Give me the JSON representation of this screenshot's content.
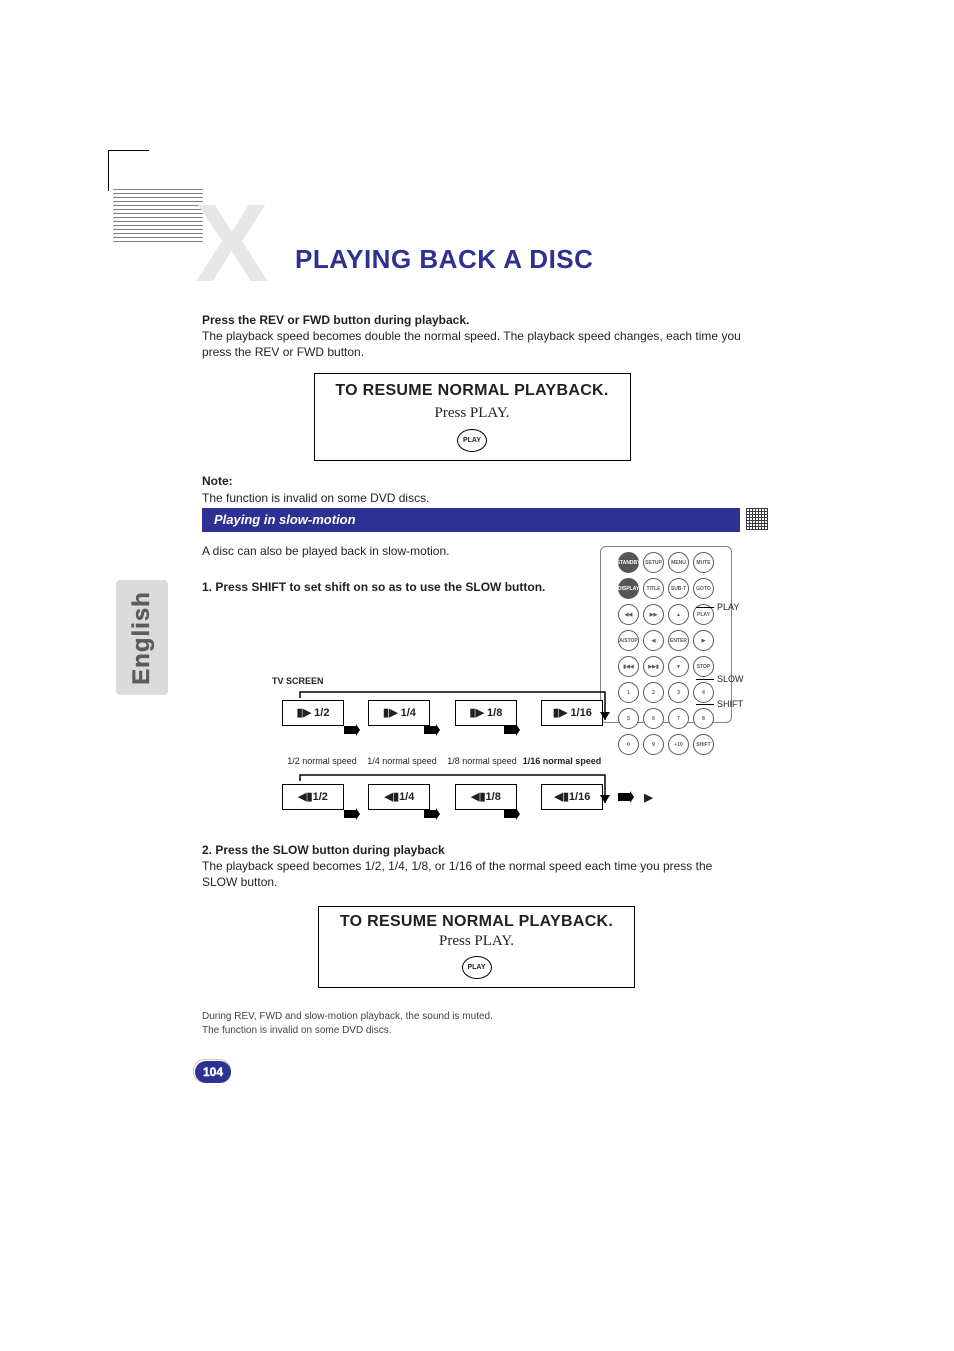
{
  "header": {
    "chapter_letter": "X",
    "title": "PLAYING BACK A DISC"
  },
  "tab": {
    "language": "English"
  },
  "sec1": {
    "b1": "Press the REV or FWD button during playback.",
    "p1": "The playback speed becomes double the normal speed. The playback speed changes, each time you press the REV or FWD button.",
    "note_label": "Note:",
    "note_text": "The function is invalid on some DVD discs."
  },
  "resume": {
    "line1": "TO RESUME NORMAL PLAYBACK.",
    "line2": "Press PLAY.",
    "btn": "PLAY"
  },
  "sec2": {
    "bar": "Playing in slow-motion",
    "intro": "A disc can also be played back in slow-motion.",
    "step1": "1. Press SHIFT to set shift on so as to use the SLOW button.",
    "tv_label": "TV SCREEN",
    "fwd": [
      "1/2",
      "1/4",
      "1/8",
      "1/16"
    ],
    "fwd_prefix": "▮▶ ",
    "rev": [
      "1/2",
      "1/4",
      "1/8",
      "1/16"
    ],
    "rev_prefix": "◀▮",
    "spd_labels": [
      "1/2 normal speed",
      "1/4 normal speed",
      "1/8 normal speed",
      "1/16 normal speed"
    ]
  },
  "callouts": {
    "play": "PLAY",
    "slow": "SLOW",
    "shift": "SHIFT"
  },
  "remote": {
    "row1": [
      "STANDBY",
      "SETUP",
      "MENU",
      "MUTE"
    ],
    "row2": [
      "DISPLAY",
      "TITLE",
      "SUB-T",
      "GOTO"
    ],
    "row3": [
      "◀◀",
      "▶▶",
      "▲",
      "PLAY"
    ],
    "row4": [
      "A/STOP",
      "◀",
      "ENTER",
      "▶"
    ],
    "row5": [
      "▮◀◀",
      "▶▶▮",
      "▼",
      "STOP"
    ],
    "row6": [
      "1",
      "2",
      "3",
      "4"
    ],
    "row7": [
      "5",
      "6",
      "7",
      "8"
    ],
    "row8": [
      "0",
      "9",
      "+10",
      "SHIFT"
    ]
  },
  "step2": {
    "b": "2. Press the SLOW button during playback",
    "p": "The playback speed becomes 1/2, 1/4, 1/8, or 1/16 of the normal speed each time you press the SLOW button."
  },
  "footnotes": {
    "a": "During REV, FWD and slow-motion playback, the sound is muted.",
    "b": "The function is invalid on some DVD discs."
  },
  "page_number": "104"
}
